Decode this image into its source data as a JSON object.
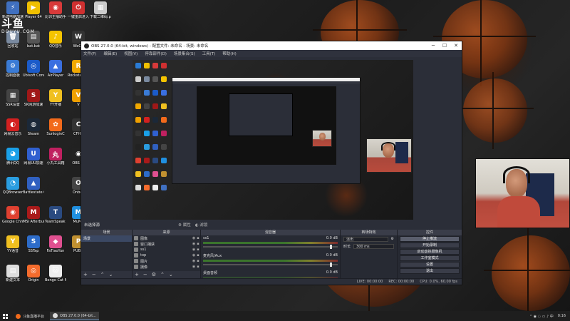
{
  "desktop": {
    "watermark": {
      "cn": "斗鱼",
      "en": "DOUYU.COM"
    },
    "icons": [
      {
        "label": "",
        "color": "#2a7bd5",
        "glyph": "▣"
      },
      {
        "label": "Player 64",
        "color": "#f0c000",
        "glyph": "▶"
      },
      {
        "label": "比邻主播助手",
        "color": "#d83a3a",
        "glyph": "◉"
      },
      {
        "label": "一键重启进入BIOS",
        "color": "#d03030",
        "glyph": "⏻"
      },
      {
        "label": "下载二维码.png",
        "color": "#cccccc",
        "glyph": "▦"
      },
      {
        "label": "回收站",
        "color": "#7a8aa0",
        "glyph": "🗑"
      },
      {
        "label": "bat.bat",
        "color": "#555555",
        "glyph": "▤"
      },
      {
        "label": "QQ音乐",
        "color": "#f5c400",
        "glyph": "♪"
      },
      {
        "label": "WeGa",
        "color": "#333333",
        "glyph": "W"
      },
      {
        "label": "控制面板",
        "color": "#3a7bd5",
        "glyph": "⚙"
      },
      {
        "label": "Ubisoft Connect",
        "color": "#1b5bc9",
        "glyph": "◎"
      },
      {
        "label": "AirPlayer",
        "color": "#3a6fe0",
        "glyph": "▲"
      },
      {
        "label": "Rockstar Games",
        "color": "#f0a800",
        "glyph": "R"
      },
      {
        "label": "SSR设置",
        "color": "#444444",
        "glyph": "▦"
      },
      {
        "label": "SK网游加速",
        "color": "#a01818",
        "glyph": "S"
      },
      {
        "label": "YY开播",
        "color": "#f0c020",
        "glyph": "Y"
      },
      {
        "label": "V",
        "color": "#f0a000",
        "glyph": "V"
      },
      {
        "label": "网易云音乐",
        "color": "#d32020",
        "glyph": "◐"
      },
      {
        "label": "Steam",
        "color": "#1b2838",
        "glyph": "◍"
      },
      {
        "label": "SunloginC",
        "color": "#f26a1b",
        "glyph": "✿"
      },
      {
        "label": "CFHD",
        "color": "#333333",
        "glyph": "C"
      },
      {
        "label": "腾讯QQ",
        "color": "#1aa0e8",
        "glyph": "◕"
      },
      {
        "label": "网易UU加速",
        "color": "#3060d0",
        "glyph": "U"
      },
      {
        "label": "小丸工具箱",
        "color": "#c02060",
        "glyph": "丸"
      },
      {
        "label": "OBS St",
        "color": "#222222",
        "glyph": "◉"
      },
      {
        "label": "QQBrowser",
        "color": "#2a9de0",
        "glyph": "◔"
      },
      {
        "label": "Battlestate Games",
        "color": "#3060c0",
        "glyph": "▲"
      },
      {
        "label": "Onbos",
        "color": "#444444",
        "glyph": "O"
      },
      {
        "label": "Google Chrome",
        "color": "#e04030",
        "glyph": "◉"
      },
      {
        "label": "MSI Afterburner",
        "color": "#aa1a1a",
        "glyph": "M"
      },
      {
        "label": "TeamSpeak 3",
        "color": "#2a4a80",
        "glyph": "T"
      },
      {
        "label": "MuMu",
        "color": "#2090e0",
        "glyph": "M"
      },
      {
        "label": "YY语音",
        "color": "#f0c020",
        "glyph": "Y"
      },
      {
        "label": "SSTap",
        "color": "#2d6cc9",
        "glyph": "S"
      },
      {
        "label": "FaTiaoYun",
        "color": "#e05090",
        "glyph": "◆"
      },
      {
        "label": "PUBG",
        "color": "#c09030",
        "glyph": "P"
      },
      {
        "label": "新建文本",
        "color": "#dddddd",
        "glyph": "▤"
      },
      {
        "label": "Origin",
        "color": "#f56c2d",
        "glyph": "◎"
      },
      {
        "label": "Bongo Cat Mver.exe",
        "color": "#eeeeee",
        "glyph": "🐱"
      },
      {
        "label": "新建电脑加速器",
        "color": "#4070c0",
        "glyph": "⚡"
      }
    ]
  },
  "obs": {
    "title": "OBS 27.0.0 (64-bit, windows) - 配置文件: 未命名 - 场景: 未命名",
    "menu": [
      "文件(F)",
      "编辑(E)",
      "视图(V)",
      "停靠部件(D)",
      "场景集合(S)",
      "工具(T)",
      "帮助(H)"
    ],
    "scene_bar": {
      "label": "未选择源",
      "props": "属性",
      "filters": "滤镜"
    },
    "docks": {
      "scenes": {
        "header": "场景",
        "items": [
          "场景"
        ]
      },
      "sources": {
        "header": "来源",
        "items": [
          "图像",
          "窗口捕获",
          "ss1",
          "top",
          "图片",
          "摄像"
        ]
      },
      "mixer": {
        "header": "混音器",
        "tracks": [
          {
            "name": "ss1",
            "db": "0.0 dB"
          },
          {
            "name": "麦克风/Aux",
            "db": "0.0 dB"
          },
          {
            "name": "桌面音频",
            "db": "0.0 dB"
          }
        ]
      },
      "transitions": {
        "header": "转场特效",
        "type": "淡出",
        "duration_label": "时长",
        "duration": "300 ms"
      },
      "controls": {
        "header": "控件",
        "buttons": [
          "停止推流",
          "开始录制",
          "启动虚拟摄像机",
          "工作室模式",
          "设置",
          "退出"
        ]
      }
    },
    "status": {
      "live": "LIVE: 00:00:00",
      "rec": "REC: 00:00:00",
      "cpu": "CPU: 0.0%, 60.00 fps"
    }
  },
  "taskbar": {
    "items": [
      {
        "label": "斗鱼直播平台",
        "color": "#f26a1b"
      },
      {
        "label": "OBS 27.0.0 (64-bit...",
        "color": "#dddddd"
      }
    ],
    "clock": "0:16"
  }
}
